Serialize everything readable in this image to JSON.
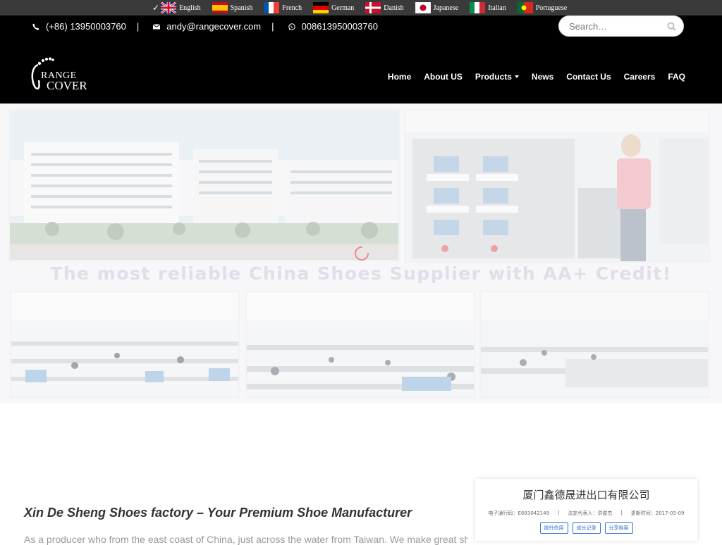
{
  "lang_bar": {
    "languages": [
      {
        "label": "English",
        "flag": "gb"
      },
      {
        "label": "Spanish",
        "flag": "es"
      },
      {
        "label": "French",
        "flag": "fr"
      },
      {
        "label": "German",
        "flag": "de"
      },
      {
        "label": "Danish",
        "flag": "dk"
      },
      {
        "label": "Japanese",
        "flag": "jp"
      },
      {
        "label": "Italian",
        "flag": "it"
      },
      {
        "label": "Portuguese",
        "flag": "pt"
      }
    ]
  },
  "contact": {
    "phone": "(+86) 13950003760",
    "email": "andy@rangecover.com",
    "whatsapp": "008613950003760",
    "separator": "|"
  },
  "search": {
    "placeholder": "Search…"
  },
  "logo": {
    "text_top": "RANGE",
    "text_bottom": "COVER"
  },
  "nav": {
    "items": [
      "Home",
      "About US",
      "Products",
      "News",
      "Contact Us",
      "Careers",
      "FAQ"
    ]
  },
  "hero": {
    "banner": "The most reliable China Shoes Supplier with AA+ Credit!"
  },
  "content": {
    "heading": "Xin De Sheng Shoes factory – Your Premium Shoe Manufacturer",
    "paragraph": "As a producer who from the east coast of China, just across the water from Taiwan. We make great shoes"
  },
  "certificate": {
    "company": "厦门鑫德晟进出口有限公司",
    "meta": [
      "电子通行码：E693042149",
      "|",
      "法定代表人：洪俊杰",
      "|",
      "更新时间：2017-05-09"
    ],
    "buttons": [
      "提升信用",
      "成长记录",
      "分享档案"
    ]
  },
  "colors": {
    "header_bg": "#000000",
    "langbar_bg": "#3a3a3a",
    "hero_bg": "#f1f0f4"
  }
}
